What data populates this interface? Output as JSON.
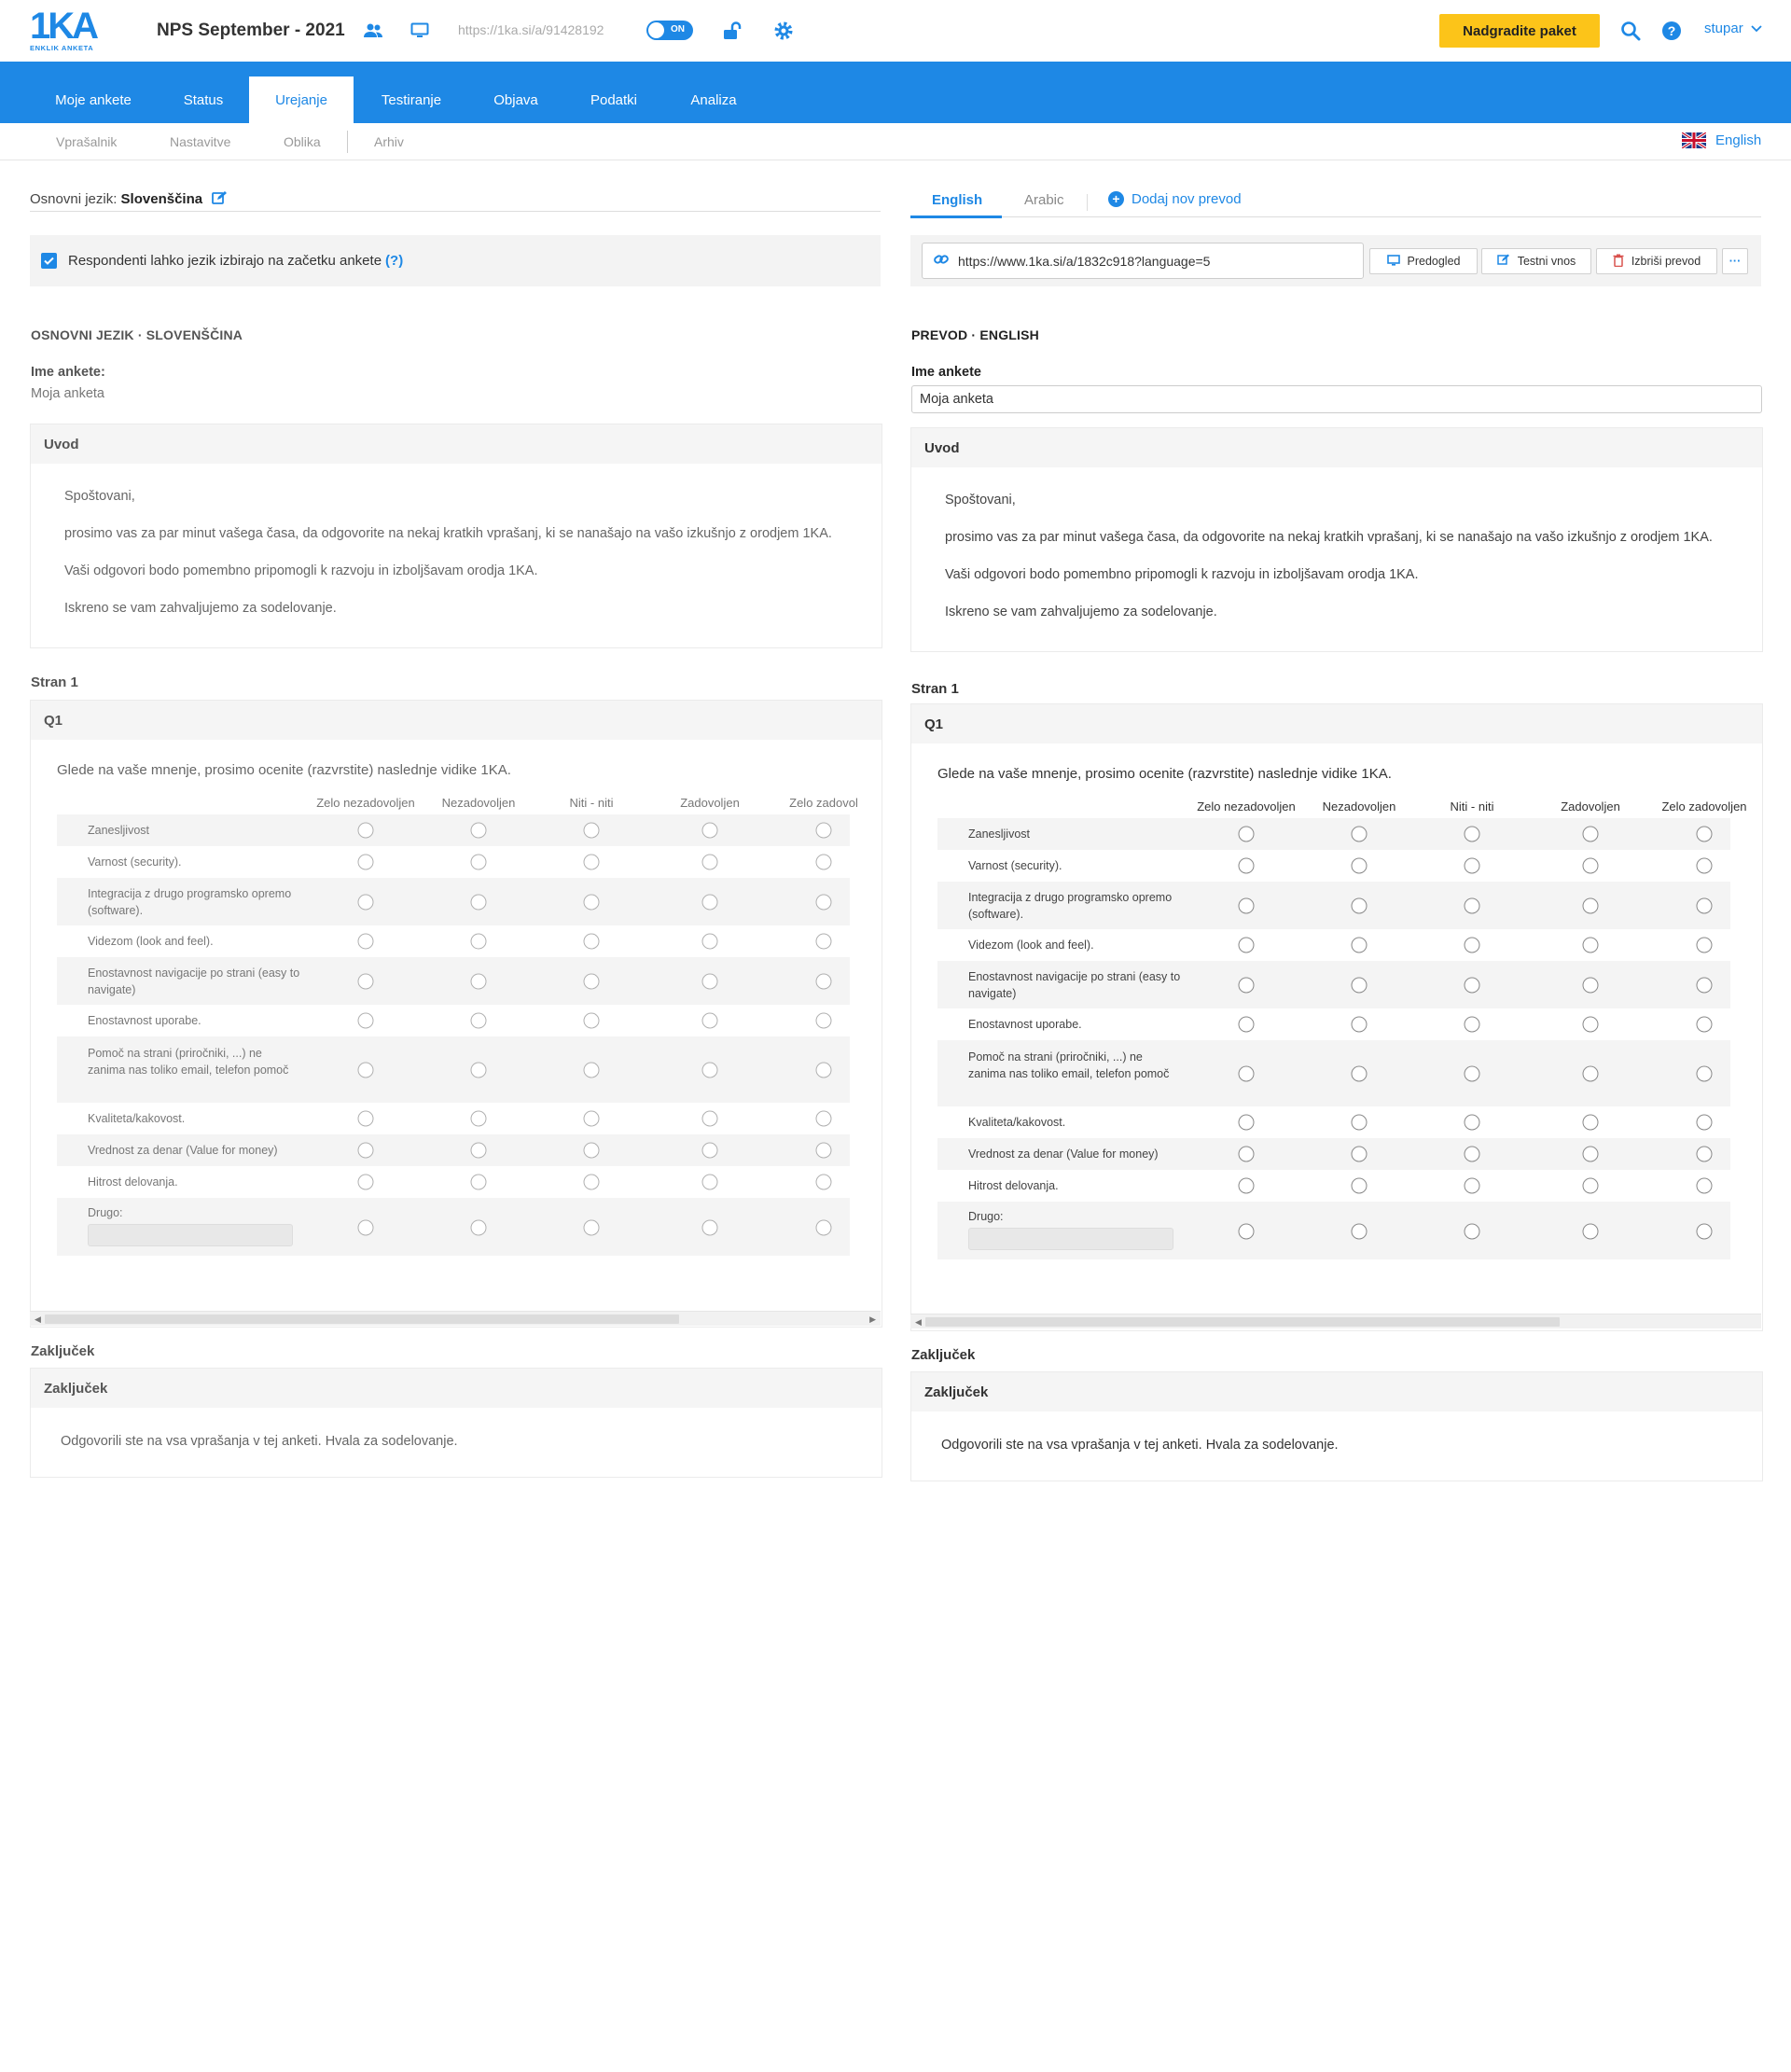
{
  "header": {
    "logo_text": "1KA",
    "logo_sub": "ENKLIK ANKETA",
    "survey_title": "NPS September - 2021",
    "survey_url": "https://1ka.si/a/91428192",
    "toggle_label": "ON",
    "upgrade_label": "Nadgradite paket",
    "user_name": "stupar",
    "icons": [
      "users-icon",
      "monitor-icon",
      "unlock-icon",
      "gear-icon",
      "search-icon",
      "help-icon",
      "chevron-down-icon"
    ],
    "accent_color": "#1e88e5",
    "upgrade_color": "#fcc419"
  },
  "main_nav": {
    "tabs": [
      {
        "label": "Moje ankete"
      },
      {
        "label": "Status"
      },
      {
        "label": "Urejanje",
        "active": true
      },
      {
        "label": "Testiranje"
      },
      {
        "label": "Objava"
      },
      {
        "label": "Podatki"
      },
      {
        "label": "Analiza"
      }
    ]
  },
  "sub_nav": {
    "items": [
      {
        "label": "Vprašalnik"
      },
      {
        "label": "Nastavitve"
      },
      {
        "label": "Oblika"
      },
      {
        "label": "Arhiv"
      }
    ],
    "language_label": "English"
  },
  "left": {
    "base_lang_prefix": "Osnovni jezik:",
    "base_lang_value": "Slovenščina",
    "respondent_checkbox_label": "Respondenti lahko jezik izbirajo na začetku ankete",
    "respondent_checkbox_checked": true,
    "help_label": "(?)",
    "section_heading": "OSNOVNI JEZIK · SLOVENŠČINA",
    "survey_name_label": "Ime ankete:",
    "survey_name_value": "Moja anketa"
  },
  "right": {
    "lang_tabs": [
      {
        "label": "English",
        "active": true
      },
      {
        "label": "Arabic"
      }
    ],
    "add_translation_label": "Dodaj nov prevod",
    "url_value": "https://www.1ka.si/a/1832c918?language=5",
    "preview_label": "Predogled",
    "test_entry_label": "Testni vnos",
    "delete_label": "Izbriši prevod",
    "more_label": "···",
    "section_heading": "PREVOD · ENGLISH",
    "survey_name_label": "Ime ankete",
    "survey_name_value": "Moja anketa"
  },
  "survey": {
    "intro_title": "Uvod",
    "intro_paragraphs": [
      "Spoštovani,",
      "prosimo vas za par minut vašega časa, da odgovorite na nekaj kratkih vprašanj, ki se nanašajo na vašo izkušnjo z orodjem 1KA.",
      "Vaši odgovori bodo pomembno pripomogli k razvoju in izboljšavam orodja 1KA.",
      "Iskreno se vam zahvaljujemo za sodelovanje."
    ],
    "page_label": "Stran 1",
    "question_id": "Q1",
    "question_text": "Glede na vaše mnenje, prosimo ocenite (razvrstite) naslednje vidike 1KA.",
    "columns": [
      "Zelo nezadovoljen",
      "Nezadovoljen",
      "Niti - niti",
      "Zadovoljen",
      "Zelo zadovoljen"
    ],
    "left_last_column_label": "Zelo zadovol",
    "rows": [
      "Zanesljivost",
      "Varnost (security).",
      "Integracija z drugo programsko opremo (software).",
      "Videzom (look and feel).",
      "Enostavnost navigacije po strani (easy to navigate)",
      "Enostavnost uporabe.",
      "Pomoč na strani (priročniki, ...) ne zanima nas toliko email, telefon pomoč",
      "Kvaliteta/kakovost.",
      "Vrednost za denar (Value for money)",
      "Hitrost delovanja.",
      "Drugo:"
    ],
    "closing_section_label": "Zaključek",
    "closing_title": "Zaključek",
    "closing_text": "Odgovorili ste na vsa vprašanja v tej anketi. Hvala za sodelovanje."
  }
}
